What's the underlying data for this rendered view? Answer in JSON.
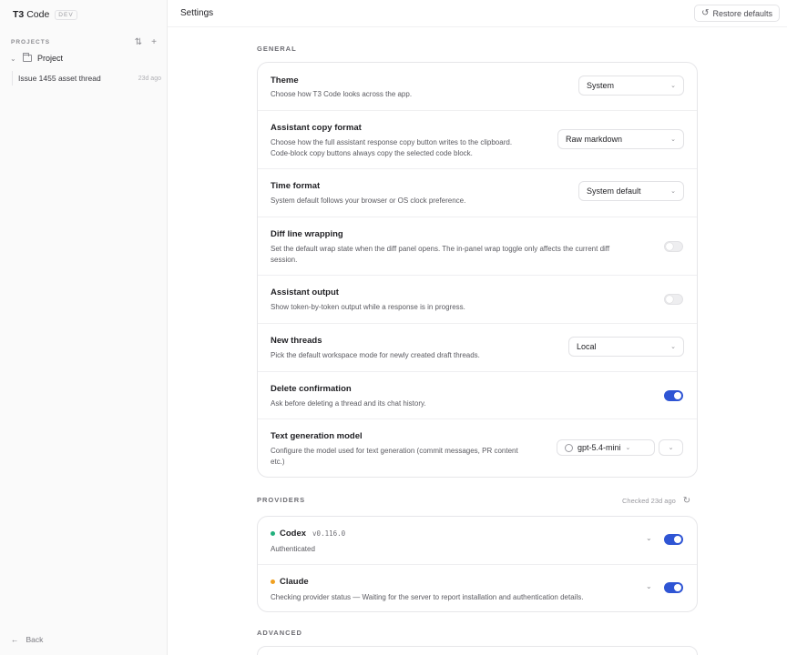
{
  "sidebar": {
    "brand": "T3",
    "brand_suffix": "Code",
    "badge": "DEV",
    "projects_label": "PROJECTS",
    "project_name": "Project",
    "thread_title": "Issue 1455 asset thread",
    "thread_time": "23d ago",
    "back_label": "Back"
  },
  "header": {
    "title": "Settings",
    "restore_label": "Restore defaults"
  },
  "general": {
    "section_label": "GENERAL",
    "theme": {
      "title": "Theme",
      "desc": "Choose how T3 Code looks across the app.",
      "value": "System"
    },
    "copy_format": {
      "title": "Assistant copy format",
      "desc1": "Choose how the full assistant response copy button writes to the clipboard.",
      "desc2": "Code-block copy buttons always copy the selected code block.",
      "value": "Raw markdown"
    },
    "time_format": {
      "title": "Time format",
      "desc": "System default follows your browser or OS clock preference.",
      "value": "System default"
    },
    "diff_wrap": {
      "title": "Diff line wrapping",
      "desc1": "Set the default wrap state when the diff panel opens. The in-panel wrap toggle only affects the current diff",
      "desc2": "session.",
      "enabled": false
    },
    "assistant_output": {
      "title": "Assistant output",
      "desc": "Show token-by-token output while a response is in progress.",
      "enabled": false
    },
    "new_threads": {
      "title": "New threads",
      "desc": "Pick the default workspace mode for newly created draft threads.",
      "value": "Local"
    },
    "delete_confirm": {
      "title": "Delete confirmation",
      "desc": "Ask before deleting a thread and its chat history.",
      "enabled": true
    },
    "text_model": {
      "title": "Text generation model",
      "desc1": "Configure the model used for text generation (commit messages, PR content",
      "desc2": "etc.)",
      "value": "gpt-5.4-mini"
    }
  },
  "providers": {
    "section_label": "PROVIDERS",
    "checked_label": "Checked 23d ago",
    "items": [
      {
        "name": "Codex",
        "version": "v0.116.0",
        "status": "Authenticated",
        "dot_color": "#22b07d",
        "enabled": true
      },
      {
        "name": "Claude",
        "version": "",
        "status": "Checking provider status — Waiting for the server to report installation and authentication details.",
        "dot_color": "#f0a020",
        "enabled": true
      }
    ]
  },
  "advanced": {
    "section_label": "ADVANCED"
  },
  "colors": {
    "accent": "#2f55d4"
  }
}
